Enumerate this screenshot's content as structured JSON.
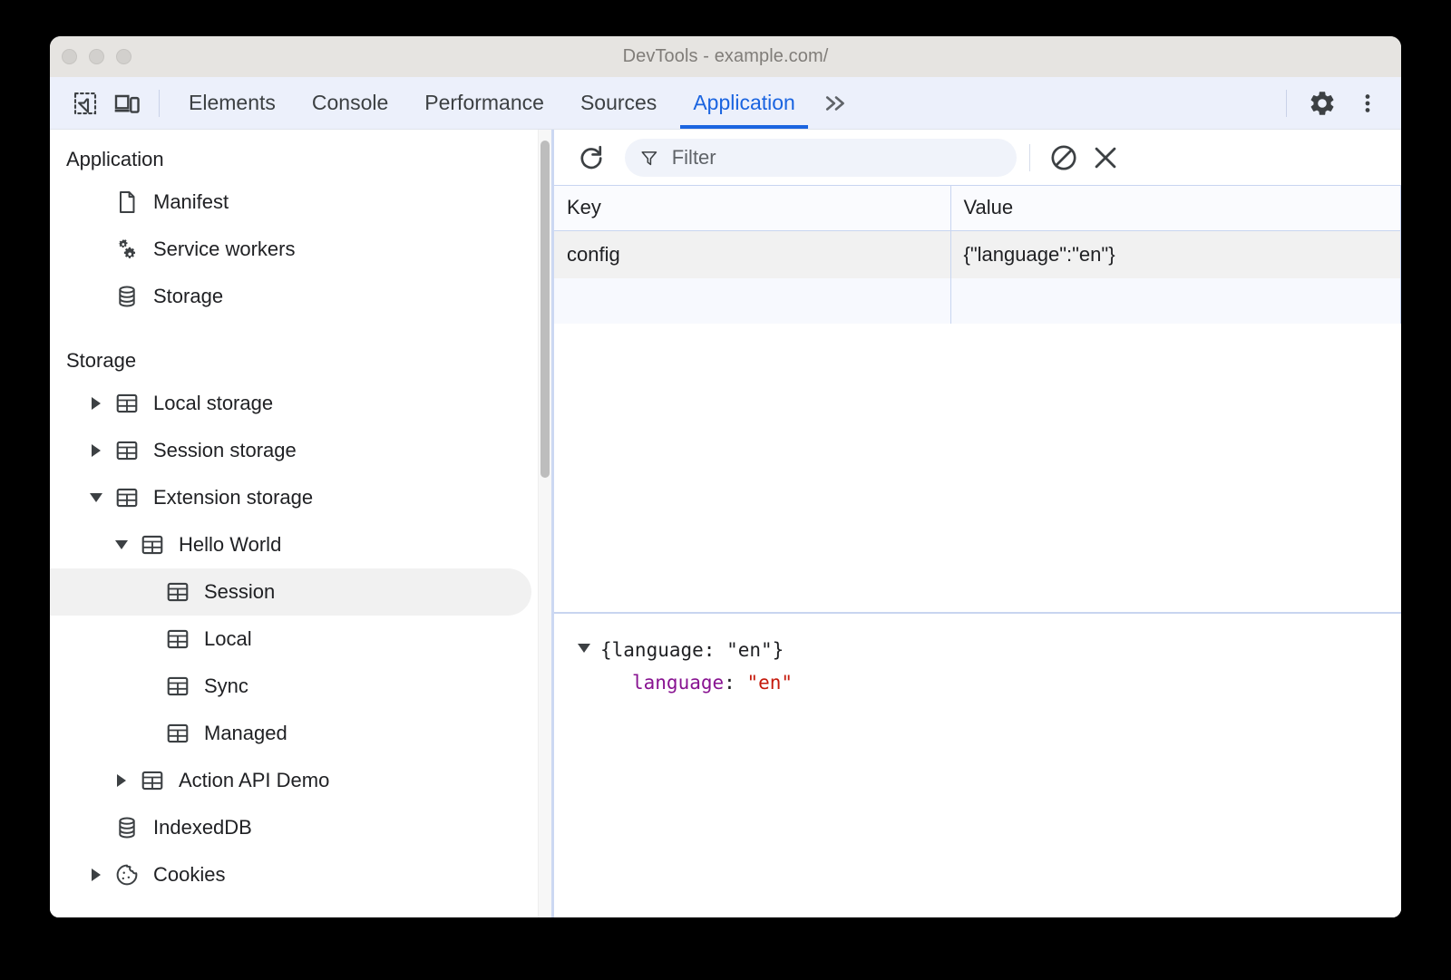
{
  "window": {
    "title": "DevTools - example.com/",
    "traffic_lights": [
      "close-button",
      "minimize-button",
      "maximize-button"
    ]
  },
  "tabbar": {
    "left_icons": [
      {
        "name": "inspect-element-icon",
        "label": "Inspect element"
      },
      {
        "name": "device-toolbar-icon",
        "label": "Toggle device toolbar"
      }
    ],
    "tabs": [
      {
        "label": "Elements",
        "active": false
      },
      {
        "label": "Console",
        "active": false
      },
      {
        "label": "Performance",
        "active": false
      },
      {
        "label": "Sources",
        "active": false
      },
      {
        "label": "Application",
        "active": true
      }
    ],
    "more_tabs_label": "»",
    "right_icons": [
      {
        "name": "settings-gear-icon",
        "label": "Settings"
      },
      {
        "name": "more-options-icon",
        "label": "Customize and control DevTools"
      }
    ],
    "active_tab_color": "#1a64e0",
    "background": "#ecf0fb"
  },
  "sidebar": {
    "sections": [
      {
        "title": "Application",
        "items": [
          {
            "label": "Manifest",
            "icon": "manifest-document-icon",
            "indent": 1,
            "arrow": "none",
            "selected": false
          },
          {
            "label": "Service workers",
            "icon": "service-workers-gears-icon",
            "indent": 1,
            "arrow": "none",
            "selected": false
          },
          {
            "label": "Storage",
            "icon": "storage-database-icon",
            "indent": 1,
            "arrow": "none",
            "selected": false
          }
        ]
      },
      {
        "title": "Storage",
        "items": [
          {
            "label": "Local storage",
            "icon": "table-icon",
            "indent": 1,
            "arrow": "closed",
            "selected": false
          },
          {
            "label": "Session storage",
            "icon": "table-icon",
            "indent": 1,
            "arrow": "closed",
            "selected": false
          },
          {
            "label": "Extension storage",
            "icon": "table-icon",
            "indent": 1,
            "arrow": "open",
            "selected": false
          },
          {
            "label": "Hello World",
            "icon": "table-icon",
            "indent": 2,
            "arrow": "open",
            "selected": false
          },
          {
            "label": "Session",
            "icon": "table-icon",
            "indent": 3,
            "arrow": "none",
            "selected": true
          },
          {
            "label": "Local",
            "icon": "table-icon",
            "indent": 3,
            "arrow": "none",
            "selected": false
          },
          {
            "label": "Sync",
            "icon": "table-icon",
            "indent": 3,
            "arrow": "none",
            "selected": false
          },
          {
            "label": "Managed",
            "icon": "table-icon",
            "indent": 3,
            "arrow": "none",
            "selected": false
          },
          {
            "label": "Action API Demo",
            "icon": "table-icon",
            "indent": 2,
            "arrow": "closed",
            "selected": false
          },
          {
            "label": "IndexedDB",
            "icon": "storage-database-icon",
            "indent": 1,
            "arrow": "none",
            "selected": false
          },
          {
            "label": "Cookies",
            "icon": "cookie-icon",
            "indent": 1,
            "arrow": "closed",
            "selected": false
          }
        ]
      }
    ],
    "scrollbar": {
      "name": "sidebar-scrollbar",
      "thumb_color": "#bdbdbd"
    }
  },
  "toolbar": {
    "refresh_label": "Refresh",
    "refresh_icon": "refresh-icon",
    "filter_icon": "filter-funnel-icon",
    "filter_placeholder": "Filter",
    "filter_value": "",
    "clear_all_icon": "clear-all-icon",
    "clear_all_label": "Clear all",
    "delete_selected_icon": "close-x-icon",
    "delete_selected_label": "Delete selected"
  },
  "table": {
    "columns": [
      "Key",
      "Value"
    ],
    "rows": [
      {
        "key": "config",
        "value": "{\"language\":\"en\"}",
        "selected": true
      }
    ],
    "empty_rows": 1
  },
  "preview": {
    "root_line": "{language: \"en\"}",
    "expanded": true,
    "entries": [
      {
        "key": "language",
        "separator": ":",
        "value": "\"en\""
      }
    ],
    "key_color": "#881391",
    "string_color": "#c5190b"
  }
}
